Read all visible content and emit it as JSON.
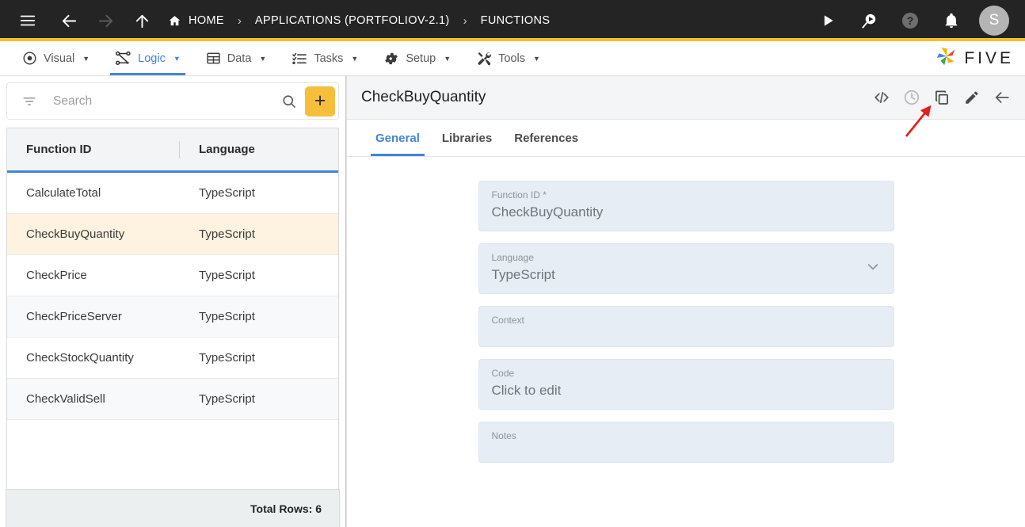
{
  "topbar": {
    "icons": {
      "menu": "hamburger-icon",
      "back": "arrow-back-icon",
      "forward": "arrow-forward-icon",
      "up": "arrow-up-icon",
      "home": "home-icon",
      "run": "play-icon",
      "run_search": "search-play-icon",
      "help": "help-circle-icon",
      "notifications": "bell-icon"
    },
    "breadcrumbs": [
      {
        "label": "HOME",
        "icon": "home-icon"
      },
      {
        "label": "APPLICATIONS (PORTFOLIOV-2.1)"
      },
      {
        "label": "FUNCTIONS"
      }
    ],
    "separator": "›",
    "avatar_initial": "S",
    "accent_color": "#f5bf2b"
  },
  "menubar": {
    "items": [
      {
        "label": "Visual",
        "icon": "eye-icon",
        "active": false
      },
      {
        "label": "Logic",
        "icon": "nodes-icon",
        "active": true
      },
      {
        "label": "Data",
        "icon": "table-icon",
        "active": false
      },
      {
        "label": "Tasks",
        "icon": "checklist-icon",
        "active": false
      },
      {
        "label": "Setup",
        "icon": "gear-icon",
        "active": false
      },
      {
        "label": "Tools",
        "icon": "tools-icon",
        "active": false
      }
    ],
    "caret": "▼",
    "brand": {
      "name": "FIVE",
      "icon": "five-pinwheel-logo"
    },
    "active_color": "#4285d6"
  },
  "left_panel": {
    "search": {
      "placeholder": "Search",
      "value": "",
      "filter_icon": "filter-icon",
      "search_icon": "search-icon"
    },
    "add_button": {
      "label": "+",
      "icon": "plus-icon",
      "color": "#f5bf3c"
    },
    "grid": {
      "columns": [
        "Function ID",
        "Language"
      ],
      "rows": [
        {
          "function_id": "CalculateTotal",
          "language": "TypeScript",
          "selected": false
        },
        {
          "function_id": "CheckBuyQuantity",
          "language": "TypeScript",
          "selected": true
        },
        {
          "function_id": "CheckPrice",
          "language": "TypeScript",
          "selected": false
        },
        {
          "function_id": "CheckPriceServer",
          "language": "TypeScript",
          "selected": false
        },
        {
          "function_id": "CheckStockQuantity",
          "language": "TypeScript",
          "selected": false
        },
        {
          "function_id": "CheckValidSell",
          "language": "TypeScript",
          "selected": false
        }
      ],
      "footer": "Total Rows: 6",
      "header_underline_color": "#4285d6",
      "selected_row_color": "#fdf3e0"
    }
  },
  "right_panel": {
    "title": "CheckBuyQuantity",
    "actions": [
      {
        "name": "code-icon",
        "glyph": "</>",
        "state": "normal"
      },
      {
        "name": "history-icon",
        "glyph": "clock",
        "state": "disabled"
      },
      {
        "name": "copy-icon",
        "glyph": "copy",
        "state": "highlighted"
      },
      {
        "name": "edit-icon",
        "glyph": "pencil",
        "state": "normal"
      },
      {
        "name": "back-icon",
        "glyph": "arrow-left",
        "state": "normal"
      }
    ],
    "tabs": [
      {
        "label": "General",
        "active": true
      },
      {
        "label": "Libraries",
        "active": false
      },
      {
        "label": "References",
        "active": false
      }
    ],
    "form": {
      "fields": [
        {
          "label": "Function ID *",
          "value": "CheckBuyQuantity",
          "type": "text"
        },
        {
          "label": "Language",
          "value": "TypeScript",
          "type": "select",
          "chevron": "chevron-down-icon"
        },
        {
          "label": "Context",
          "value": "",
          "type": "text"
        },
        {
          "label": "Code",
          "value": "Click to edit",
          "type": "text"
        },
        {
          "label": "Notes",
          "value": "",
          "type": "textarea"
        }
      ]
    },
    "annotation": {
      "type": "arrow",
      "color": "#e81c1c",
      "points_to": "copy-icon"
    }
  }
}
